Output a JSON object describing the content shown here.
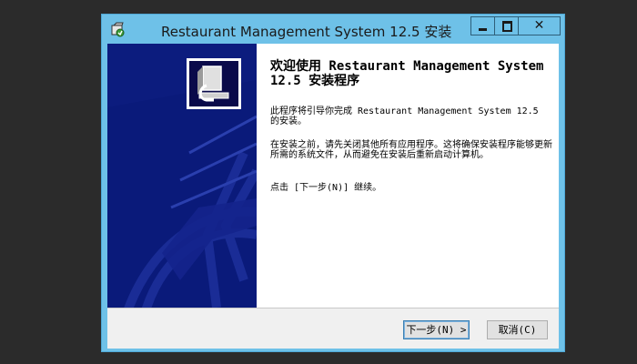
{
  "window": {
    "title": "Restaurant Management System 12.5 安装",
    "close_glyph": "✕"
  },
  "content": {
    "heading": "欢迎使用 Restaurant Management System 12.5 安装程序",
    "paragraph1": "此程序将引导你完成 Restaurant Management System 12.5 的安装。",
    "paragraph2": "在安装之前，请先关闭其他所有应用程序。这将确保安装程序能够更新所需的系统文件，从而避免在安装后重新启动计算机。",
    "paragraph3": "点击 [下一步(N)] 继续。"
  },
  "buttons": {
    "next": "下一步(N) >",
    "cancel": "取消(C)"
  },
  "icons": {
    "app": "installer-icon",
    "banner": "installer-logo-icon"
  },
  "colors": {
    "titlebar": "#6ec1e8",
    "banner": "#0a1a7a"
  }
}
